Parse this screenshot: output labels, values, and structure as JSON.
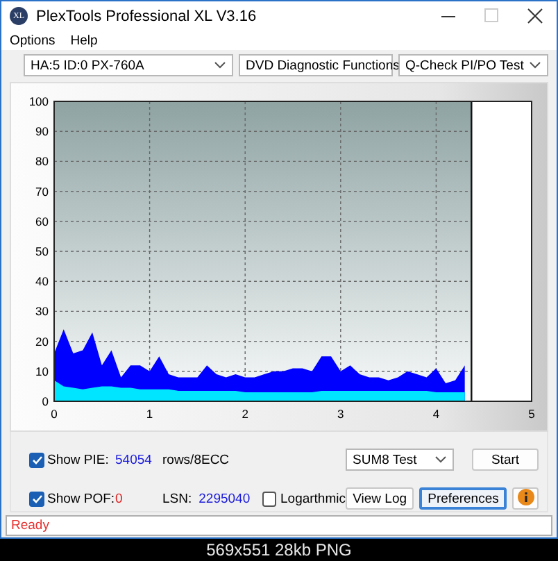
{
  "window": {
    "app_icon_text": "XL",
    "title": "PlexTools Professional XL V3.16"
  },
  "menu": [
    "Options",
    "Help"
  ],
  "toolbar": {
    "selects": [
      {
        "value": "HA:5 ID:0  PX-760A"
      },
      {
        "value": "DVD Diagnostic Functions"
      },
      {
        "value": "Q-Check PI/PO Test"
      }
    ]
  },
  "chart": {
    "chart_data": {
      "type": "area",
      "grid": true,
      "bands": [
        {
          "axis": "x",
          "from": 4.37,
          "to": 5,
          "color": "#ffffff"
        }
      ],
      "ref_lines": [
        {
          "axis": "x",
          "value": 4.37,
          "color": "#111111"
        }
      ],
      "xlim": [
        0,
        5
      ],
      "ylim": [
        0,
        100
      ],
      "xticks": [
        0,
        1,
        2,
        3,
        4,
        5
      ],
      "yticks": [
        0,
        10,
        20,
        30,
        40,
        50,
        60,
        70,
        80,
        90,
        100
      ],
      "x": [
        0,
        0.1,
        0.2,
        0.3,
        0.4,
        0.5,
        0.6,
        0.7,
        0.8,
        0.9,
        1.0,
        1.1,
        1.2,
        1.3,
        1.4,
        1.5,
        1.6,
        1.7,
        1.8,
        1.9,
        2.0,
        2.1,
        2.2,
        2.3,
        2.4,
        2.5,
        2.6,
        2.7,
        2.8,
        2.9,
        3.0,
        3.1,
        3.2,
        3.3,
        3.4,
        3.5,
        3.6,
        3.7,
        3.8,
        3.9,
        4.0,
        4.1,
        4.2,
        4.3
      ],
      "series": [
        {
          "color": "#0000ff",
          "values": [
            16,
            24,
            16,
            17,
            23,
            12,
            17,
            8,
            12,
            12,
            10,
            15,
            9,
            8,
            8,
            8,
            12,
            9,
            8,
            9,
            8,
            8,
            9,
            10,
            10,
            11,
            11,
            10,
            15,
            15,
            10,
            12,
            9,
            8,
            8,
            7,
            8,
            10,
            9,
            8,
            11,
            6,
            7,
            12
          ]
        },
        {
          "color": "#00e5ff",
          "values": [
            7,
            5,
            4.5,
            4,
            4.5,
            5,
            5,
            4.5,
            4.5,
            4,
            4,
            4,
            4,
            3.5,
            3.5,
            3.5,
            3.5,
            3.5,
            3.5,
            3.5,
            3,
            3,
            3,
            3,
            3,
            3,
            3,
            3,
            3.5,
            3.5,
            3.5,
            3.5,
            3.5,
            3.5,
            3.5,
            3.5,
            3.5,
            3.5,
            3.5,
            3.5,
            3,
            3,
            3,
            3
          ]
        }
      ]
    }
  },
  "controls": {
    "show_pie": {
      "label": "Show PIE:",
      "checked": true,
      "value": "54054",
      "unit": "rows/8ECC"
    },
    "show_pof": {
      "label": "Show POF:",
      "checked": true,
      "value": "0"
    },
    "lsn": {
      "label": "LSN:",
      "value": "2295040"
    },
    "logarithmic": {
      "label": "Logarthmic",
      "checked": false
    },
    "test_select": {
      "value": "SUM8 Test"
    },
    "buttons": [
      {
        "kind": "text",
        "label": "Start"
      },
      {
        "kind": "text",
        "label": "View Log"
      },
      {
        "kind": "text",
        "label": "Preferences",
        "focused": true
      },
      {
        "kind": "info"
      }
    ]
  },
  "status_bar": {
    "text": "Ready"
  },
  "caption": "569x551 28kb PNG"
}
